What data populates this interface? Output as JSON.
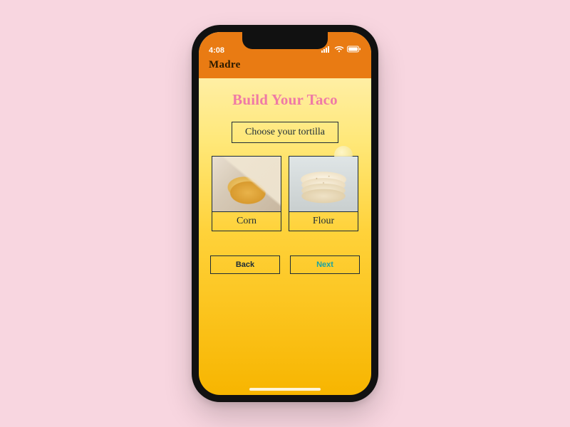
{
  "status": {
    "time": "4:08"
  },
  "header": {
    "brand": "Madre"
  },
  "page": {
    "title": "Build Your Taco",
    "subtitle": "Choose your tortilla"
  },
  "options": [
    {
      "label": "Corn"
    },
    {
      "label": "Flour"
    }
  ],
  "nav": {
    "back": "Back",
    "next": "Next"
  },
  "colors": {
    "accent_orange": "#e97b13",
    "title_pink": "#ef7aa6",
    "next_teal": "#1aa3a3",
    "outline": "#1c2b36"
  }
}
